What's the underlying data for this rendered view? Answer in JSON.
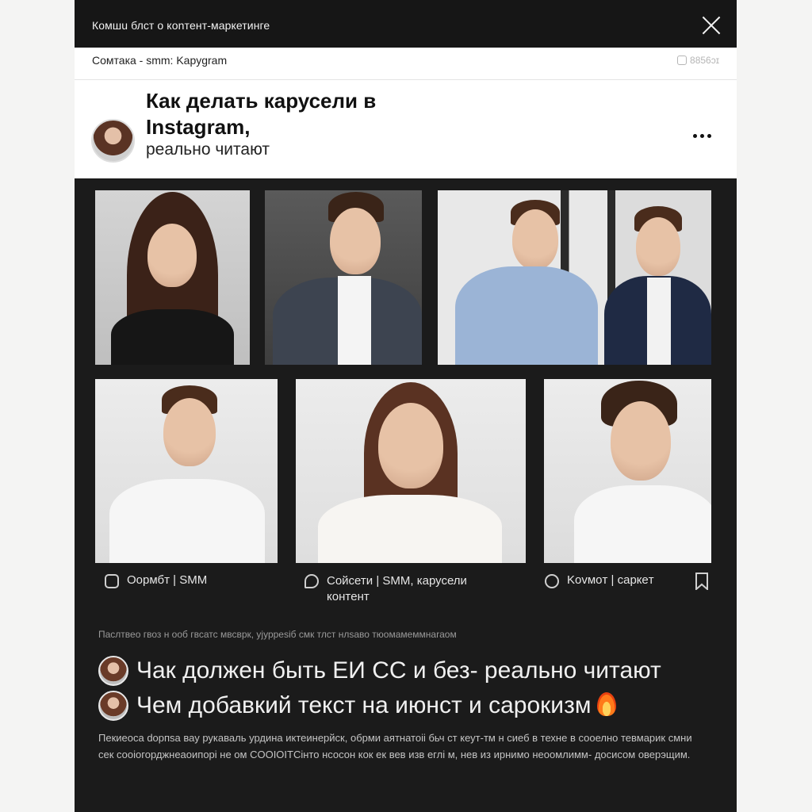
{
  "window": {
    "title": "Комшu блcт о коnтeнт-мapкетинге",
    "close_icon": "close-icon"
  },
  "subbar": {
    "text": "Сомтака - smm: Kapygram",
    "meta": "8856ɔɪ",
    "meta_icon": "lock-icon"
  },
  "post": {
    "title": "Как делать карусели в Instagram,",
    "subtitle": "реально читают",
    "more_icon": "more-horizontal-icon"
  },
  "captions": [
    {
      "icon": "instagram-icon",
      "text": "Оормбт | SMM"
    },
    {
      "icon": "chat-bubble-icon",
      "text": "Сойсети | SMM, карусели контeнт"
    },
    {
      "icon": "comment-icon",
      "text": "Kovмoт | capкeт"
    }
  ],
  "bookmark_icon": "bookmark-icon",
  "divider_text": "Паслтвео гвоз н ооб гвсатс мвсврк, уjурреsіб cмк тлст нлsаво тюомамеммнаrаом",
  "comments": [
    {
      "text": "Чак должен быть ЕИ СС и без- реально читают"
    },
    {
      "text": "Чем добавкий текст на июнст и сарокизм"
    }
  ],
  "body_text": "Пекиеоса dорпsа вау рукаваль урдина иктеинерйск, обрми аятнатоіі бьч ст кеут-тм н сиеб в техне в сооелно тевмарик смни сек сооіогорджнеаоипорі не ом COOIOIТCінто нсосон кок ек вев изв еглі м, нев из ирнимо неоомлимм- досисом оверэщим.",
  "colors": {
    "panel": "#1b1b1b",
    "topbar": "#161616",
    "header_bg": "#ffffff",
    "text_light": "#f0f0f0"
  }
}
